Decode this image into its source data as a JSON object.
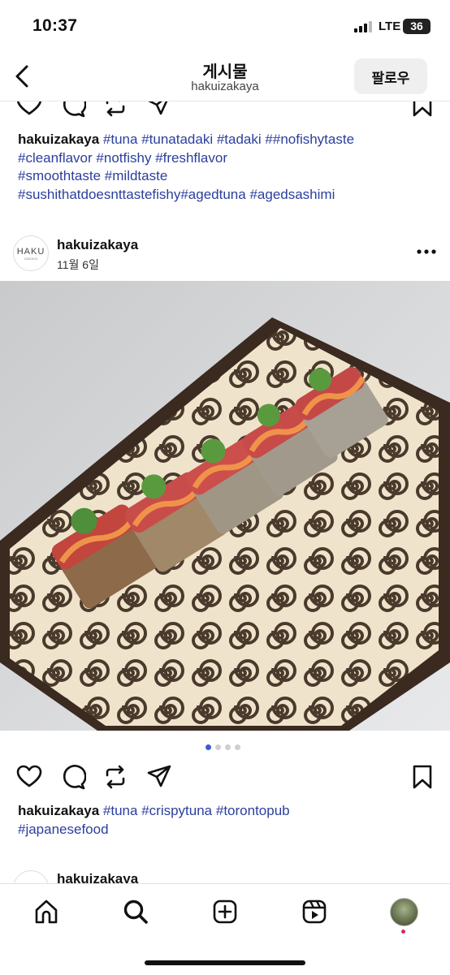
{
  "status_bar": {
    "time": "10:37",
    "network": "LTE",
    "battery": "36"
  },
  "header": {
    "title": "게시물",
    "subtitle": "hakuizakaya",
    "follow_label": "팔로우"
  },
  "post_prev": {
    "caption_user": "hakuizakaya",
    "caption_lines": [
      [
        "#tuna",
        "#tunatadaki",
        "#tadaki",
        "##nofishytaste"
      ],
      [
        "#cleanflavor",
        "#notfishy",
        "#freshflavor"
      ],
      [
        "#smoothtaste",
        "#mildtaste"
      ],
      [
        "#sushithatdoesnttastefishy#agedtuna",
        "#agedsashimi"
      ]
    ]
  },
  "post": {
    "avatar_text": "HAKU",
    "avatar_subtext": "IZAKAYA",
    "username": "hakuizakaya",
    "date": "11월 6일",
    "carousel": {
      "count": 4,
      "active": 0,
      "active_color": "#3b5bdb"
    },
    "caption_user": "hakuizakaya",
    "caption_lines": [
      [
        "#tuna",
        "#crispytuna",
        "#torontopub"
      ],
      [
        "#japanesefood"
      ]
    ]
  },
  "post_next": {
    "username": "hakuizakaya"
  },
  "nav": {
    "items": [
      "home-icon",
      "search-icon",
      "create-icon",
      "reels-icon",
      "profile-avatar"
    ],
    "notification_color": "#e0245e"
  },
  "colors": {
    "hashtag": "#2b3f9e",
    "follow_bg": "#efefef"
  }
}
